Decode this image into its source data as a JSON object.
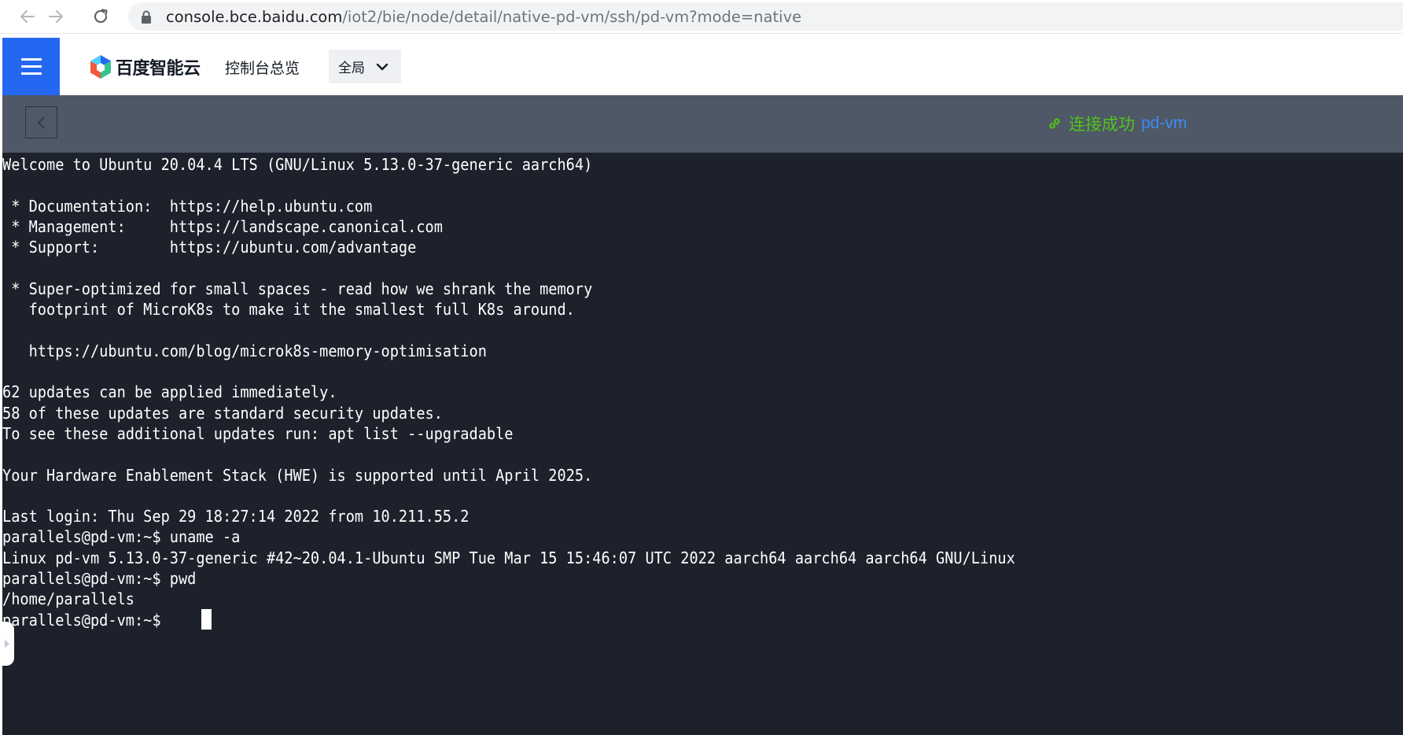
{
  "browser": {
    "url_host": "console.bce.baidu.com",
    "url_path": "/iot2/bie/node/detail/native-pd-vm/ssh/pd-vm?mode=native"
  },
  "header": {
    "logo_text": "百度智能云",
    "overview_label": "控制台总览",
    "region_label": "全局"
  },
  "toolbar": {
    "status_text": "连接成功",
    "host_name": "pd-vm"
  },
  "terminal": {
    "lines": [
      "Welcome to Ubuntu 20.04.4 LTS (GNU/Linux 5.13.0-37-generic aarch64)",
      "",
      " * Documentation:  https://help.ubuntu.com",
      " * Management:     https://landscape.canonical.com",
      " * Support:        https://ubuntu.com/advantage",
      "",
      " * Super-optimized for small spaces - read how we shrank the memory",
      "   footprint of MicroK8s to make it the smallest full K8s around.",
      "",
      "   https://ubuntu.com/blog/microk8s-memory-optimisation",
      "",
      "62 updates can be applied immediately.",
      "58 of these updates are standard security updates.",
      "To see these additional updates run: apt list --upgradable",
      "",
      "Your Hardware Enablement Stack (HWE) is supported until April 2025.",
      "",
      "Last login: Thu Sep 29 18:27:14 2022 from 10.211.55.2",
      "parallels@pd-vm:~$ uname -a",
      "Linux pd-vm 5.13.0-37-generic #42~20.04.1-Ubuntu SMP Tue Mar 15 15:46:07 UTC 2022 aarch64 aarch64 aarch64 GNU/Linux",
      "parallels@pd-vm:~$ pwd",
      "/home/parallels",
      "parallels@pd-vm:~$ "
    ]
  },
  "icons": {
    "back": "arrow-left-icon",
    "forward": "arrow-right-icon",
    "reload": "reload-icon",
    "lock": "lock-icon",
    "menu": "hamburger-menu-icon",
    "logo": "baidu-cloud-logo-icon",
    "dropdown": "chevron-down-icon",
    "terminal_back": "chevron-left-icon",
    "link": "link-icon",
    "side_handle": "caret-right-icon"
  },
  "colors": {
    "accent_blue": "#2468f2",
    "success_green": "#52c41a",
    "host_blue": "#3b8cf5",
    "terminal_bg": "#1c212b",
    "toolbar_bg": "#4f5866"
  }
}
